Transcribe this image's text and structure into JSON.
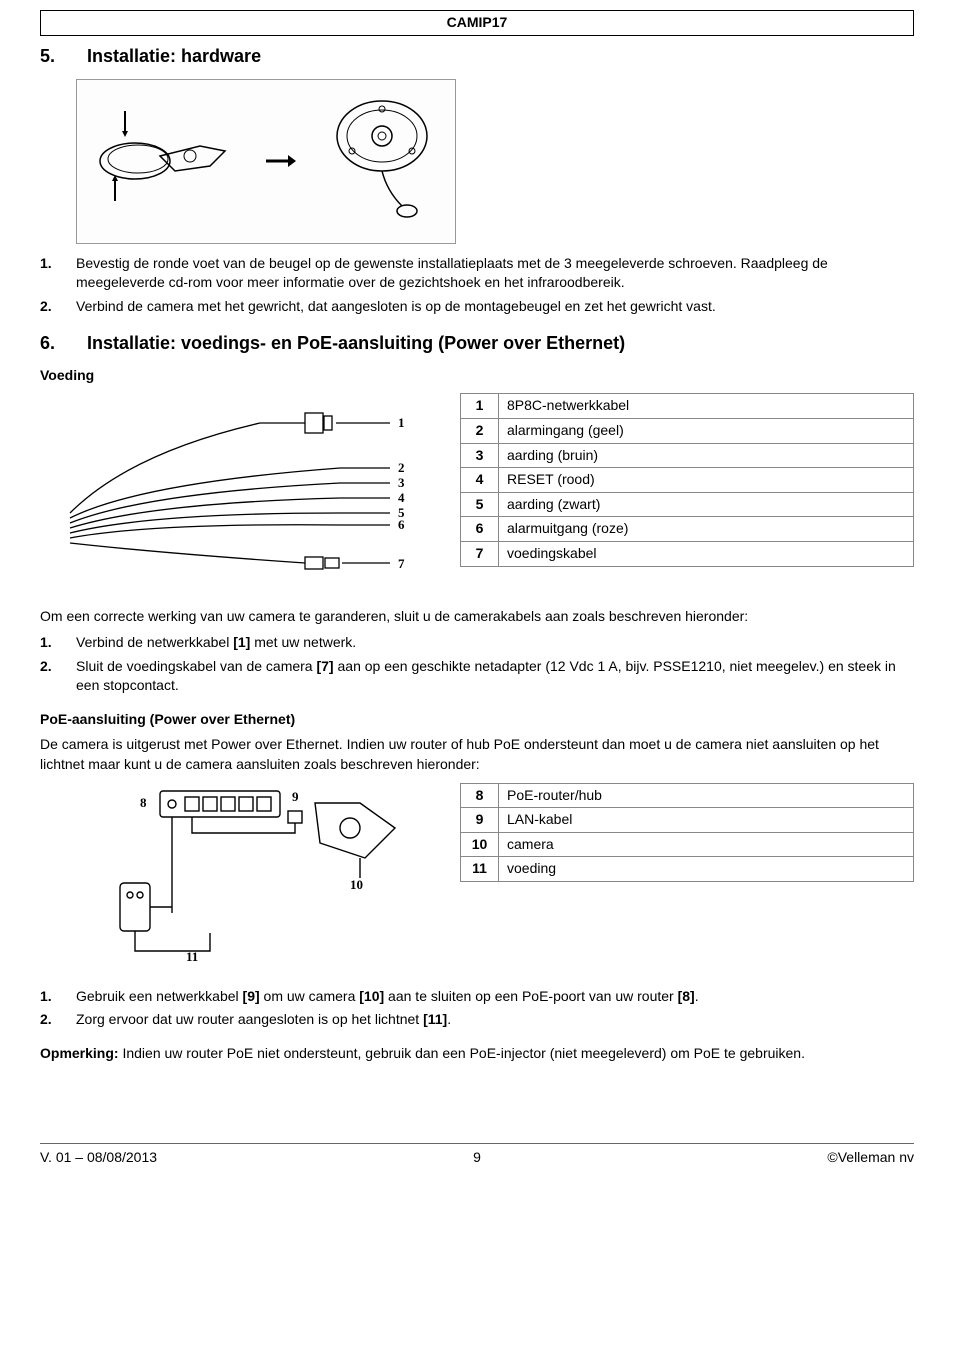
{
  "header": "CAMIP17",
  "s5": {
    "num": "5.",
    "title": "Installatie: hardware",
    "steps": [
      {
        "n": "1.",
        "t": "Bevestig de ronde voet van de beugel op de gewenste installatieplaats met de 3 meegeleverde schroeven. Raadpleeg de meegeleverde cd-rom voor meer informatie over de gezichtshoek en het infraroodbereik."
      },
      {
        "n": "2.",
        "t": "Verbind de camera met het gewricht, dat aangesloten is op de montagebeugel en zet het gewricht vast."
      }
    ]
  },
  "s6": {
    "num": "6.",
    "title": "Installatie: voedings- en PoE-aansluiting (Power over Ethernet)",
    "voeding_heading": "Voeding",
    "wires": [
      {
        "k": "1",
        "v": "8P8C-netwerkkabel"
      },
      {
        "k": "2",
        "v": "alarmingang (geel)"
      },
      {
        "k": "3",
        "v": "aarding (bruin)"
      },
      {
        "k": "4",
        "v": "RESET (rood)"
      },
      {
        "k": "5",
        "v": "aarding (zwart)"
      },
      {
        "k": "6",
        "v": "alarmuitgang (roze)"
      },
      {
        "k": "7",
        "v": "voedingskabel"
      }
    ],
    "voeding_intro": "Om een correcte werking van uw camera te garanderen, sluit u de camerakabels aan zoals beschreven hieronder:",
    "voeding_steps": [
      {
        "n": "1.",
        "t_pre": "Verbind de netwerkkabel ",
        "b1": "[1]",
        "t_post": " met uw netwerk."
      },
      {
        "n": "2.",
        "t_pre": "Sluit de voedingskabel van de camera ",
        "b1": "[7]",
        "t_post": " aan op een geschikte netadapter (12 Vdc 1 A, bijv. PSSE1210, niet meegelev.) en steek in een stopcontact."
      }
    ],
    "poe_heading": "PoE-aansluiting (Power over Ethernet)",
    "poe_intro": "De camera is uitgerust met Power over Ethernet. Indien uw router of hub PoE ondersteunt dan moet u de camera niet aansluiten op het lichtnet maar kunt u de camera aansluiten zoals beschreven hieronder:",
    "poe_table": [
      {
        "k": "8",
        "v": "PoE-router/hub"
      },
      {
        "k": "9",
        "v": "LAN-kabel"
      },
      {
        "k": "10",
        "v": "camera"
      },
      {
        "k": "11",
        "v": "voeding"
      }
    ],
    "poe_steps": [
      {
        "n": "1.",
        "t_pre": "Gebruik een netwerkkabel ",
        "b1": "[9]",
        "t_mid": " om uw camera ",
        "b2": "[10]",
        "t_mid2": " aan te sluiten op een PoE-poort van uw router ",
        "b3": "[8]",
        "t_post": "."
      },
      {
        "n": "2.",
        "t_pre": "Zorg ervoor dat uw router aangesloten is op het lichtnet ",
        "b1": "[11]",
        "t_post": "."
      }
    ],
    "note_label": "Opmerking:",
    "note_text": " Indien uw router PoE niet ondersteunt, gebruik dan een PoE-injector (niet meegeleverd) om PoE te gebruiken."
  },
  "diagram_labels": {
    "voeding": {
      "l1": "1",
      "l2": "2",
      "l3": "3",
      "l4": "4",
      "l5": "5",
      "l6": "6",
      "l7": "7"
    },
    "poe": {
      "l8": "8",
      "l9": "9",
      "l10": "10",
      "l11": "11"
    }
  },
  "footer": {
    "left": "V. 01 – 08/08/2013",
    "center": "9",
    "right": "©Velleman nv"
  }
}
